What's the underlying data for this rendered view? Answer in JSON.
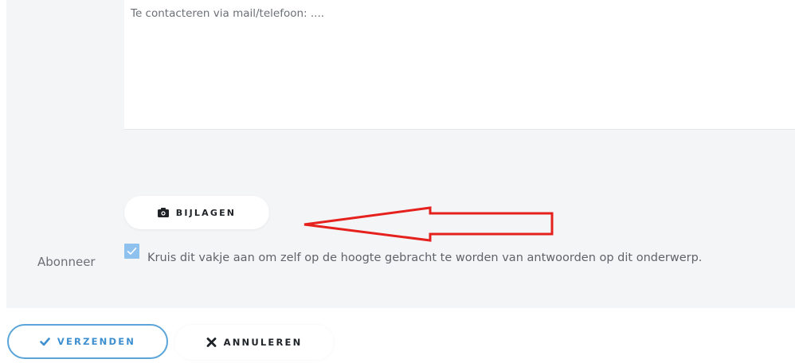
{
  "message": {
    "value": "Te contacteren via mail/telefoon: ...."
  },
  "attachments": {
    "label": "BIJLAGEN",
    "icon": "camera-icon"
  },
  "annotation": {
    "icon": "arrow-left-icon",
    "color": "#e5211e"
  },
  "subscribe": {
    "label": "Abonneer",
    "checkbox_checked": true,
    "checkbox_text": "Kruis dit vakje aan om zelf op de hoogte gebracht te worden van antwoorden op dit onderwerp.",
    "checkbox_color": "#8fc1ee"
  },
  "actions": {
    "submit_label": "VERZENDEN",
    "submit_icon": "checkmark-icon",
    "cancel_label": "ANNULEREN",
    "cancel_icon": "close-icon",
    "accent_color": "#3d8fd0"
  }
}
